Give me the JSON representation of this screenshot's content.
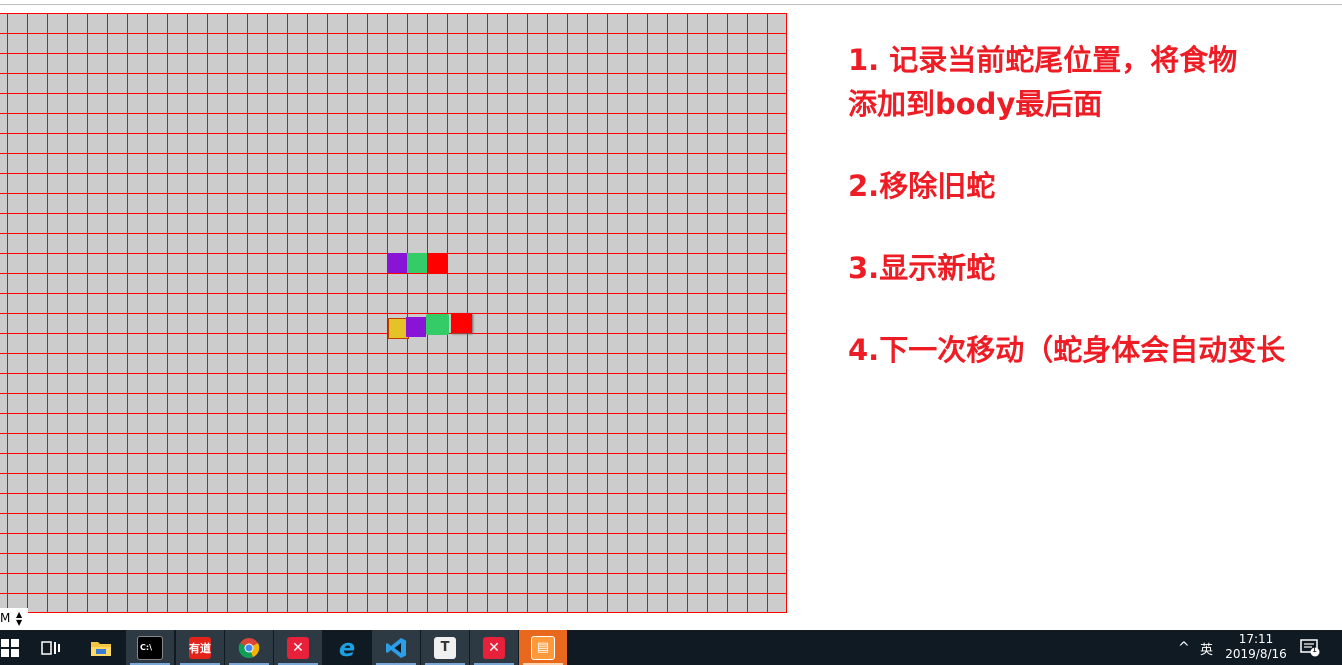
{
  "steps": [
    "1. 记录当前蛇尾位置，将食物\n添加到body最后面",
    "2.移除旧蛇",
    "3.显示新蛇",
    "4.下一次移动（蛇身体会自动变长"
  ],
  "colors": {
    "board_bg": "#cccccc",
    "grid_line": "#ff0000",
    "text": "#ee1c24",
    "snake_head": "#ff0000",
    "snake_body1": "#33cc66",
    "snake_body2": "#8a14d6",
    "food": "#e6c229",
    "taskbar": "#101a22"
  },
  "select": {
    "value": "M"
  },
  "taskbar": {
    "apps": [
      "start-icon",
      "task-view-icon",
      "file-explorer-icon",
      "terminal-icon",
      "youdao-icon",
      "chrome-icon",
      "xmind-icon",
      "ie-icon",
      "vscode-icon",
      "typora-icon",
      "xmind-icon-2",
      "sublime-icon"
    ],
    "tray": {
      "chevron": "^",
      "lang": "英",
      "time": "17:11",
      "date": "2019/8/16",
      "notifications": "1"
    }
  }
}
